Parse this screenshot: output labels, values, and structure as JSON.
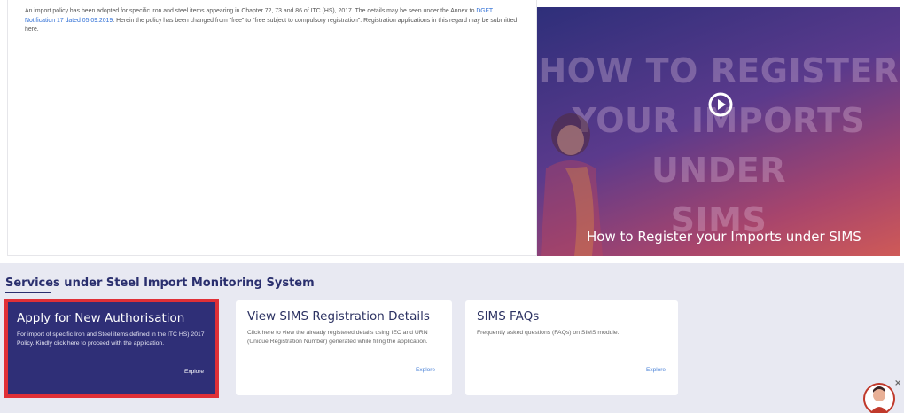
{
  "intro": {
    "text_before_link": "An import policy has been adopted for specific iron and steel items appearing in Chapter 72, 73 and 86 of ITC (HS), 2017. The details may be seen under the Annex to ",
    "link": "DGFT Notification 17 dated 05.09.2019",
    "text_after_link": ". Herein the policy has been changed from \"free\" to \"free subject to compulsory registration\". Registration applications in this regard may be submitted here."
  },
  "video": {
    "background_text": [
      "HOW TO REGISTER",
      "YOUR IMPORTS UNDER",
      "SIMS"
    ],
    "caption": "How to Register your Imports under SIMS",
    "play_icon": "play-circle-icon"
  },
  "services": {
    "title": "Services under Steel Import Monitoring System",
    "cards": [
      {
        "title": "Apply for New Authorisation",
        "description": "For import of specific Iron and Steel items defined in the ITC HS) 2017 Policy. Kindly click here to proceed with the application.",
        "explore": "Explore"
      },
      {
        "title": "View SIMS Registration Details",
        "description": "Click here to view the already registered details using IEC and URN (Unique Registration Number) generated while filing the application.",
        "explore": "Explore"
      },
      {
        "title": "SIMS FAQs",
        "description": "Frequently asked questions (FAQs) on SIMS module.",
        "explore": "Explore"
      }
    ]
  },
  "chatbot": {
    "icon": "chatbot-avatar-icon",
    "close": "×"
  },
  "colors": {
    "accent": "#2f2f77",
    "highlight_border": "#e03037",
    "link": "#2f6fd6",
    "services_bg": "#e8e9f2"
  }
}
